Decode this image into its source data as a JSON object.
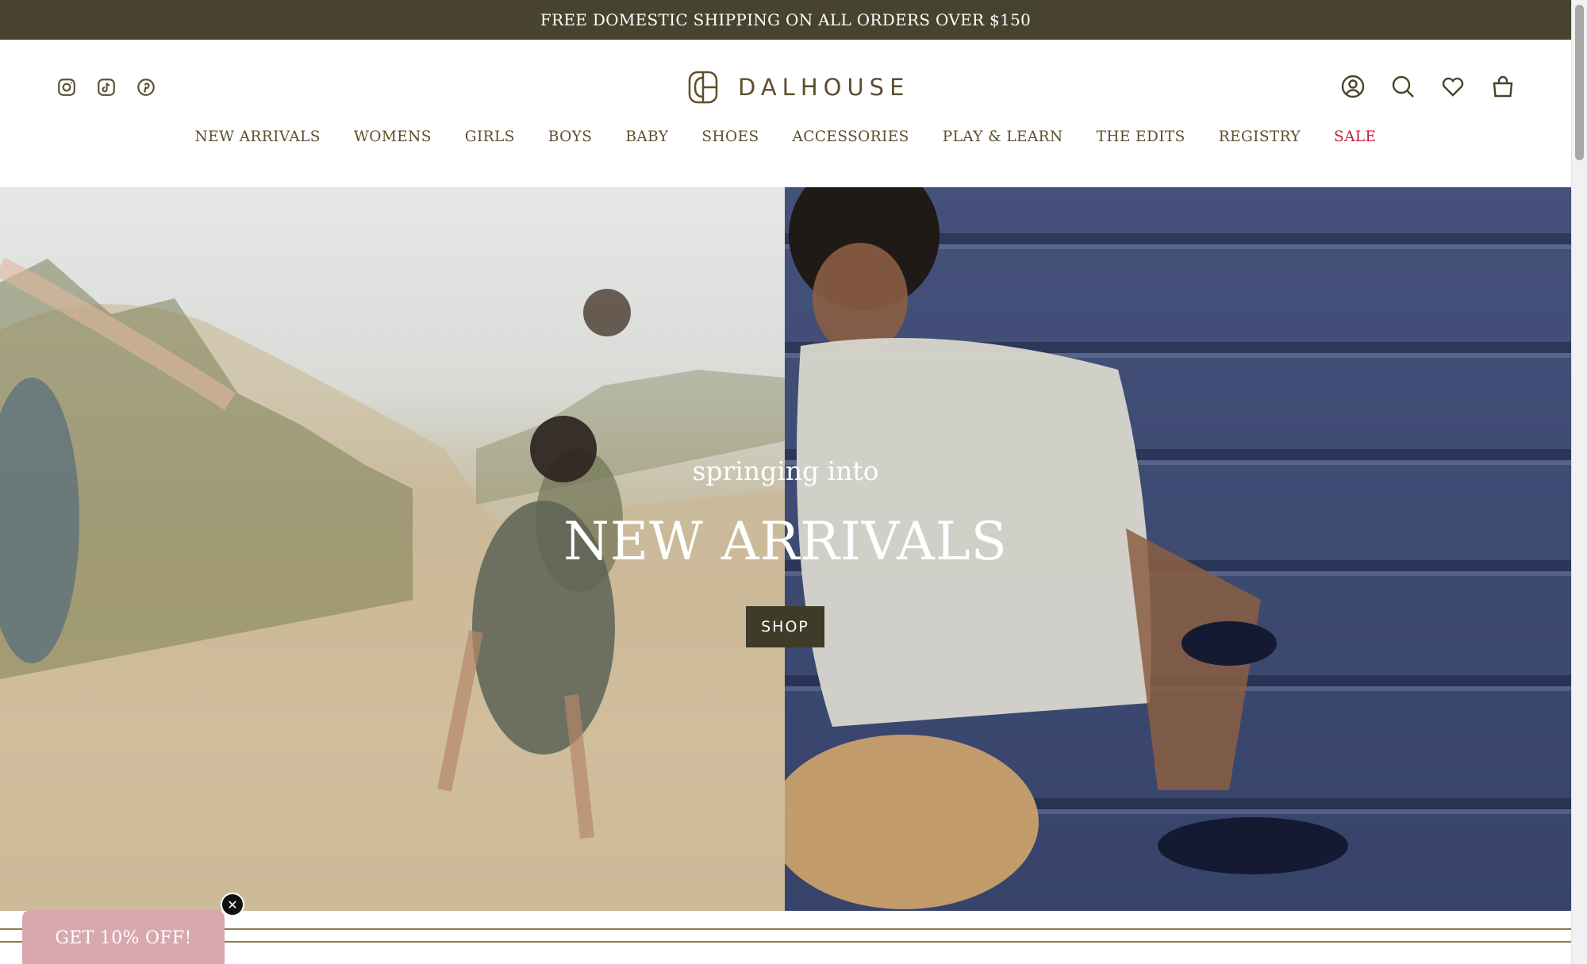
{
  "announcement": {
    "text": "FREE DOMESTIC SHIPPING ON ALL ORDERS OVER $150"
  },
  "header": {
    "social": [
      {
        "icon": "instagram-icon"
      },
      {
        "icon": "tiktok-icon"
      },
      {
        "icon": "pinterest-icon"
      }
    ],
    "logo": {
      "text": "DALHOUSE"
    },
    "utility": [
      {
        "icon": "account-icon"
      },
      {
        "icon": "search-icon"
      },
      {
        "icon": "heart-icon"
      },
      {
        "icon": "bag-icon"
      }
    ]
  },
  "nav": [
    {
      "label": "NEW ARRIVALS"
    },
    {
      "label": "WOMENS"
    },
    {
      "label": "GIRLS"
    },
    {
      "label": "BOYS"
    },
    {
      "label": "BABY"
    },
    {
      "label": "SHOES"
    },
    {
      "label": "ACCESSORIES"
    },
    {
      "label": "PLAY & LEARN"
    },
    {
      "label": "THE EDITS"
    },
    {
      "label": "REGISTRY"
    },
    {
      "label": "SALE"
    }
  ],
  "hero": {
    "subtitle": "springing into",
    "title": "NEW ARRIVALS",
    "button": "SHOP"
  },
  "promo": {
    "label": "GET 10% OFF!"
  },
  "colors": {
    "brand_dark": "#47432e",
    "brand_text": "#5d4f2c",
    "sale": "#c41e3a",
    "promo": "#d8a8ae"
  }
}
